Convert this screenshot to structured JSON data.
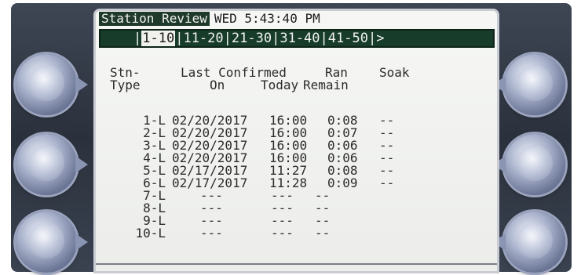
{
  "screen": {
    "title": "Station Review",
    "datetime": "WED 5:43:40 PM",
    "tabs": [
      "1-10",
      "11-20",
      "21-30",
      "31-40",
      "41-50",
      ">"
    ],
    "active_tab": "1-10"
  },
  "columns": {
    "stn_line1": "Stn-",
    "stn_line2": "Type",
    "last_line1": "Last Confirmed",
    "last_line2": "On",
    "ran_line1": "Ran",
    "ran_line2": "Today",
    "remain_line2": "Remain",
    "soak_line1": "Soak"
  },
  "rows": [
    {
      "stn": "1-L",
      "date": "02/20/2017",
      "time": "16:00",
      "ran": "0:08",
      "soak": "--"
    },
    {
      "stn": "2-L",
      "date": "02/20/2017",
      "time": "16:00",
      "ran": "0:07",
      "soak": "--"
    },
    {
      "stn": "3-L",
      "date": "02/20/2017",
      "time": "16:00",
      "ran": "0:06",
      "soak": "--"
    },
    {
      "stn": "4-L",
      "date": "02/20/2017",
      "time": "16:00",
      "ran": "0:06",
      "soak": "--"
    },
    {
      "stn": "5-L",
      "date": "02/17/2017",
      "time": "11:27",
      "ran": "0:08",
      "soak": "--"
    },
    {
      "stn": "6-L",
      "date": "02/17/2017",
      "time": "11:28",
      "ran": "0:09",
      "soak": "--"
    },
    {
      "stn": "7-L",
      "date": "---",
      "time": "---",
      "ran": "--",
      "soak": ""
    },
    {
      "stn": "8-L",
      "date": "---",
      "time": "---",
      "ran": "--",
      "soak": ""
    },
    {
      "stn": "9-L",
      "date": "---",
      "time": "---",
      "ran": "--",
      "soak": ""
    },
    {
      "stn": "10-L",
      "date": "---",
      "time": "---",
      "ran": "--",
      "soak": ""
    }
  ]
}
